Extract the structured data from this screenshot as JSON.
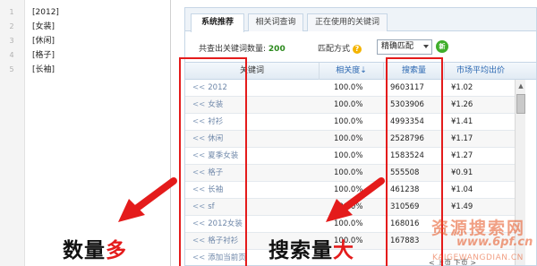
{
  "editor": {
    "lines": [
      {
        "num": "1",
        "text": "[2012]"
      },
      {
        "num": "2",
        "text": "[女装]"
      },
      {
        "num": "3",
        "text": "[休闲]"
      },
      {
        "num": "4",
        "text": "[格子]"
      },
      {
        "num": "5",
        "text": "[长袖]"
      }
    ]
  },
  "tabs": [
    {
      "label": "系统推荐"
    },
    {
      "label": "相关词查询"
    },
    {
      "label": "正在使用的关键词"
    }
  ],
  "summary": {
    "label": "共查出关键词数量:",
    "count": "200"
  },
  "match": {
    "label": "匹配方式",
    "help": "?",
    "value": "精确匹配",
    "go": "新"
  },
  "columns": {
    "keyword": "关键词",
    "relevance": "相关度",
    "search": "搜索量",
    "price": "市场平均出价"
  },
  "rows": [
    {
      "keyword": "2012",
      "relevance": "100.0%",
      "search": "9603117",
      "price": "¥1.02"
    },
    {
      "keyword": "女装",
      "relevance": "100.0%",
      "search": "5303906",
      "price": "¥1.26"
    },
    {
      "keyword": "衬衫",
      "relevance": "100.0%",
      "search": "4993354",
      "price": "¥1.41"
    },
    {
      "keyword": "休闲",
      "relevance": "100.0%",
      "search": "2528796",
      "price": "¥1.17"
    },
    {
      "keyword": "夏季女装",
      "relevance": "100.0%",
      "search": "1583524",
      "price": "¥1.27"
    },
    {
      "keyword": "格子",
      "relevance": "100.0%",
      "search": "555508",
      "price": "¥0.91"
    },
    {
      "keyword": "长袖",
      "relevance": "100.0%",
      "search": "461238",
      "price": "¥1.04"
    },
    {
      "keyword": "sf",
      "relevance": "100.0%",
      "search": "310569",
      "price": "¥1.49"
    },
    {
      "keyword": "2012女装",
      "relevance": "100.0%",
      "search": "168016",
      "price": ""
    },
    {
      "keyword": "格子衬衫",
      "relevance": "100.0%",
      "search": "167883",
      "price": ""
    },
    {
      "keyword": "添加当前页",
      "relevance": "",
      "search": "",
      "price": ""
    }
  ],
  "pager": {
    "text": "< 上页 下页 >"
  },
  "annotations": {
    "left_main": "数量",
    "left_hl": "多",
    "right_main": "搜索量",
    "right_hl": "大"
  },
  "watermark": {
    "line1": "资源搜索网",
    "line2": "www.6pf.cn",
    "line3": "KAIGEWANGDIAN.CN"
  },
  "colors": {
    "annotation_red": "#e41b1b",
    "count_green": "#2c8a1e",
    "keyword_link": "#6d86a8"
  }
}
